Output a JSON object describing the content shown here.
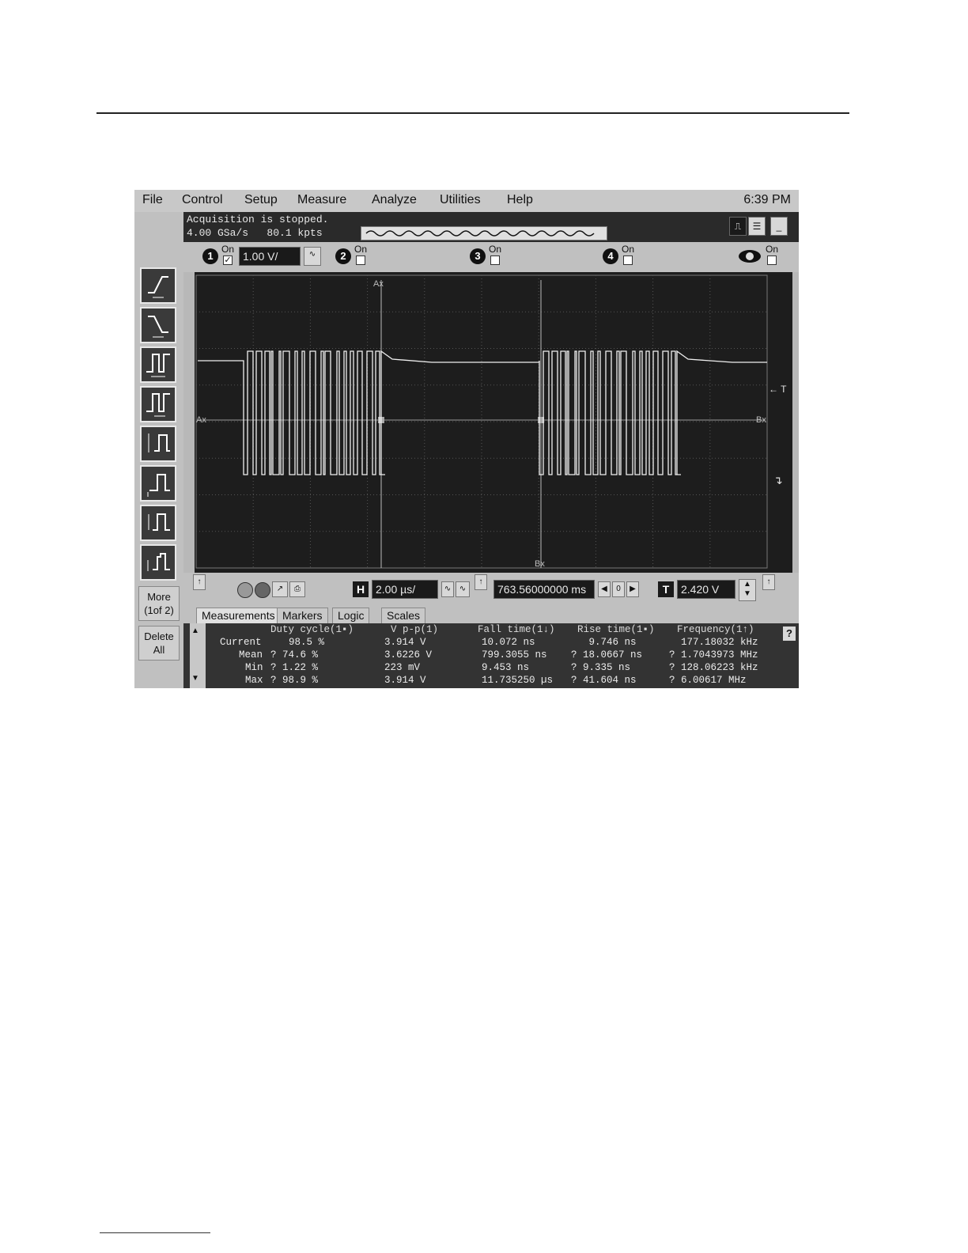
{
  "menu": {
    "items": [
      "File",
      "Control",
      "Setup",
      "Measure",
      "Analyze",
      "Utilities",
      "Help"
    ],
    "clock": "6:39 PM"
  },
  "status": {
    "line1": "Acquisition is stopped.",
    "line2": "4.00 GSa/s   80.1 kpts"
  },
  "channels": {
    "ch1": {
      "num": "1",
      "on": "On",
      "scale": "1.00 V/"
    },
    "ch2": {
      "num": "2",
      "on": "On"
    },
    "ch3": {
      "num": "3",
      "on": "On"
    },
    "ch4": {
      "num": "4",
      "on": "On"
    },
    "math": {
      "on": "On"
    }
  },
  "graticule": {
    "ax_top": "Ax",
    "ax_left": "Ax",
    "bx_right": "Bx",
    "bx_bottom": "Bx",
    "trigger_marker": "← T"
  },
  "side": {
    "more": "More",
    "more_page": "(1of 2)",
    "delete": "Delete",
    "delete_all": "All"
  },
  "controls": {
    "h_label": "H",
    "timebase": "2.00 µs/",
    "position": "763.56000000 ms",
    "position_nav": "0",
    "t_label": "T",
    "trigger_level": "2.420 V"
  },
  "tabs": [
    "Measurements",
    "Markers",
    "Logic",
    "Scales"
  ],
  "measurements": {
    "headers": [
      "Duty cycle(1▪)",
      "V p-p(1)",
      "Fall time(1↓)",
      "Rise time(1▪)",
      "Frequency(1↑)"
    ],
    "rows": [
      {
        "label": "Current",
        "duty": "  98.5 %",
        "vpp": "3.914 V",
        "fall": "  10.072 ns",
        "rise": "   9.746 ns",
        "freq": "  177.18032 kHz"
      },
      {
        "label": "Mean",
        "duty": "? 74.6 %",
        "vpp": "3.6226 V",
        "fall": "  799.3055 ns",
        "rise": "? 18.0667 ns",
        "freq": "? 1.7043973 MHz"
      },
      {
        "label": "Min",
        "duty": "? 1.22 %",
        "vpp": "223 mV",
        "fall": "  9.453 ns",
        "rise": "? 9.335 ns",
        "freq": "? 128.06223 kHz"
      },
      {
        "label": "Max",
        "duty": "? 98.9 %",
        "vpp": "3.914 V",
        "fall": "  11.735250 µs",
        "rise": "? 41.604 ns",
        "freq": "? 6.00617 MHz"
      }
    ]
  }
}
